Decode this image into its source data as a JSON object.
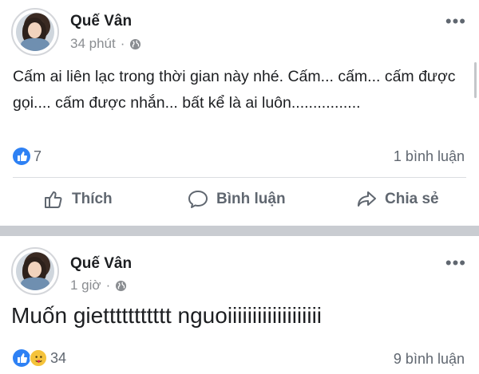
{
  "posts": [
    {
      "author": "Quế Vân",
      "time": "34 phút",
      "text": "Cấm ai liên lạc trong thời gian này nhé. Cấm... cấm... cấm được gọi.... cấm được nhắn... bất kể là ai luôn................",
      "reaction_count": "7",
      "comments": "1 bình luận",
      "actions": {
        "like": "Thích",
        "comment": "Bình luận",
        "share": "Chia sẻ"
      }
    },
    {
      "author": "Quế Vân",
      "time": "1 giờ",
      "text": "Muốn giettttttttttt nguoiiiiiiiiiiiiiiiiiii",
      "reaction_count": "34",
      "comments": "9 bình luận"
    }
  ],
  "colors": {
    "like_blue": "#2e81f4",
    "separator": "#c9ccd1",
    "muted_text": "#606770"
  }
}
